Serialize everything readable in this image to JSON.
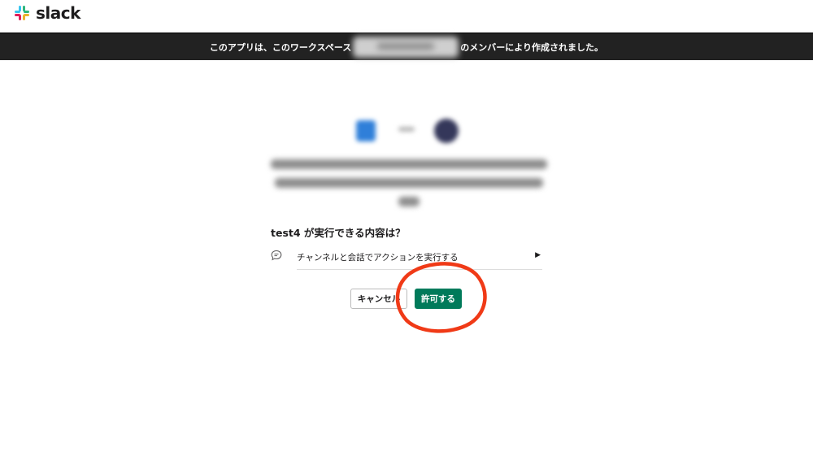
{
  "header": {
    "logo_text": "slack",
    "logo_icon": "slack-hash-icon"
  },
  "banner": {
    "text_before": "このアプリは、このワークスペース",
    "text_after": "のメンバーにより作成されました。"
  },
  "permissions": {
    "title": "test4 が実行できる内容は？",
    "items": [
      {
        "icon": "chat-bubble-icon",
        "label": "チャンネルと会話でアクションを実行する"
      }
    ]
  },
  "buttons": {
    "cancel_label": "キャンセル",
    "allow_label": "許可する"
  },
  "colors": {
    "banner_bg": "#222222",
    "allow_green": "#007a5a",
    "annotation_red": "#f03a17"
  }
}
